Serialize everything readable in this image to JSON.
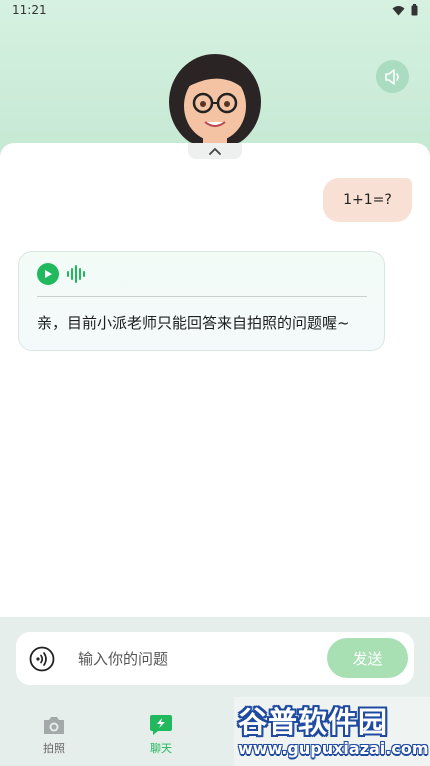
{
  "status_bar": {
    "time": "11:21"
  },
  "header": {
    "avatar_icon": "teacher-avatar",
    "speaker_icon": "speaker-icon"
  },
  "chat": {
    "messages": [
      {
        "role": "user",
        "text": "1+1=?"
      },
      {
        "role": "assistant",
        "text": "亲，目前小派老师只能回答来自拍照的问题喔~"
      }
    ]
  },
  "input": {
    "placeholder": "输入你的问题",
    "value": "",
    "send_label": "发送"
  },
  "bottom_nav": {
    "items": [
      {
        "label": "拍照",
        "icon": "camera-icon",
        "active": false
      },
      {
        "label": "聊天",
        "icon": "chat-lightning-icon",
        "active": true
      }
    ]
  },
  "watermark": {
    "title": "谷普软件园",
    "url": "www.gupuxiazai.com"
  },
  "colors": {
    "accent_green": "#22b85e",
    "send_button": "#a8e0b4",
    "user_bubble": "#f9e0d5",
    "header_bg": "#d6f1e1"
  }
}
